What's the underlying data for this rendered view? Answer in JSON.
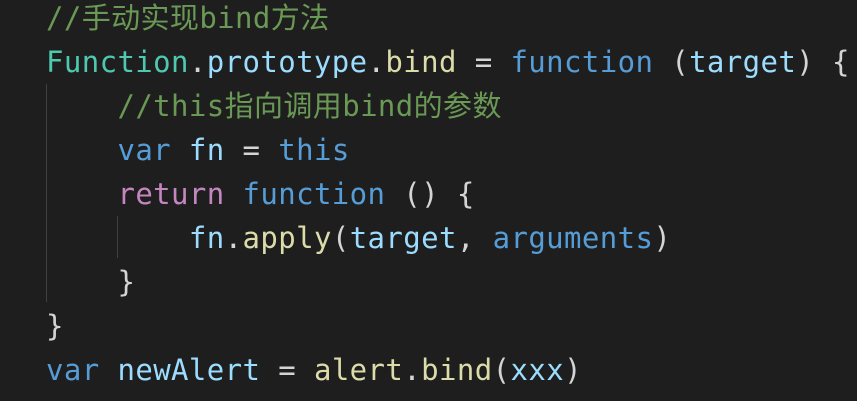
{
  "editor": {
    "background": "#1e1e1e",
    "colors": {
      "comment": "#6a9955",
      "class": "#4ec9b0",
      "function": "#dcdcaa",
      "property": "#9cdcfe",
      "keyword": "#569cd6",
      "control": "#c586c0",
      "plain": "#d4d4d4"
    },
    "lines": [
      {
        "tokens": [
          {
            "type": "comment",
            "text": "//手动实现bind方法"
          }
        ]
      },
      {
        "tokens": [
          {
            "type": "class",
            "text": "Function"
          },
          {
            "type": "plain",
            "text": "."
          },
          {
            "type": "prop",
            "text": "prototype"
          },
          {
            "type": "plain",
            "text": "."
          },
          {
            "type": "func",
            "text": "bind"
          },
          {
            "type": "plain",
            "text": " = "
          },
          {
            "type": "keyword",
            "text": "function"
          },
          {
            "type": "plain",
            "text": " ("
          },
          {
            "type": "param",
            "text": "target"
          },
          {
            "type": "plain",
            "text": ") {"
          }
        ]
      },
      {
        "tokens": [
          {
            "type": "plain",
            "text": "    "
          },
          {
            "type": "comment",
            "text": "//this指向调用bind的参数"
          }
        ]
      },
      {
        "tokens": [
          {
            "type": "plain",
            "text": "    "
          },
          {
            "type": "keyword",
            "text": "var"
          },
          {
            "type": "plain",
            "text": " "
          },
          {
            "type": "var",
            "text": "fn"
          },
          {
            "type": "plain",
            "text": " = "
          },
          {
            "type": "keyword",
            "text": "this"
          }
        ]
      },
      {
        "tokens": [
          {
            "type": "plain",
            "text": "    "
          },
          {
            "type": "control",
            "text": "return"
          },
          {
            "type": "plain",
            "text": " "
          },
          {
            "type": "keyword",
            "text": "function"
          },
          {
            "type": "plain",
            "text": " () {"
          }
        ]
      },
      {
        "tokens": [
          {
            "type": "plain",
            "text": "        "
          },
          {
            "type": "var",
            "text": "fn"
          },
          {
            "type": "plain",
            "text": "."
          },
          {
            "type": "func",
            "text": "apply"
          },
          {
            "type": "plain",
            "text": "("
          },
          {
            "type": "var",
            "text": "target"
          },
          {
            "type": "plain",
            "text": ", "
          },
          {
            "type": "keyword",
            "text": "arguments"
          },
          {
            "type": "plain",
            "text": ")"
          }
        ]
      },
      {
        "tokens": [
          {
            "type": "plain",
            "text": "    }"
          }
        ]
      },
      {
        "tokens": [
          {
            "type": "plain",
            "text": "}"
          }
        ]
      },
      {
        "tokens": [
          {
            "type": "keyword",
            "text": "var"
          },
          {
            "type": "plain",
            "text": " "
          },
          {
            "type": "var",
            "text": "newAlert"
          },
          {
            "type": "plain",
            "text": " = "
          },
          {
            "type": "func",
            "text": "alert"
          },
          {
            "type": "plain",
            "text": "."
          },
          {
            "type": "func",
            "text": "bind"
          },
          {
            "type": "plain",
            "text": "("
          },
          {
            "type": "var",
            "text": "xxx"
          },
          {
            "type": "plain",
            "text": ")"
          }
        ]
      }
    ]
  }
}
